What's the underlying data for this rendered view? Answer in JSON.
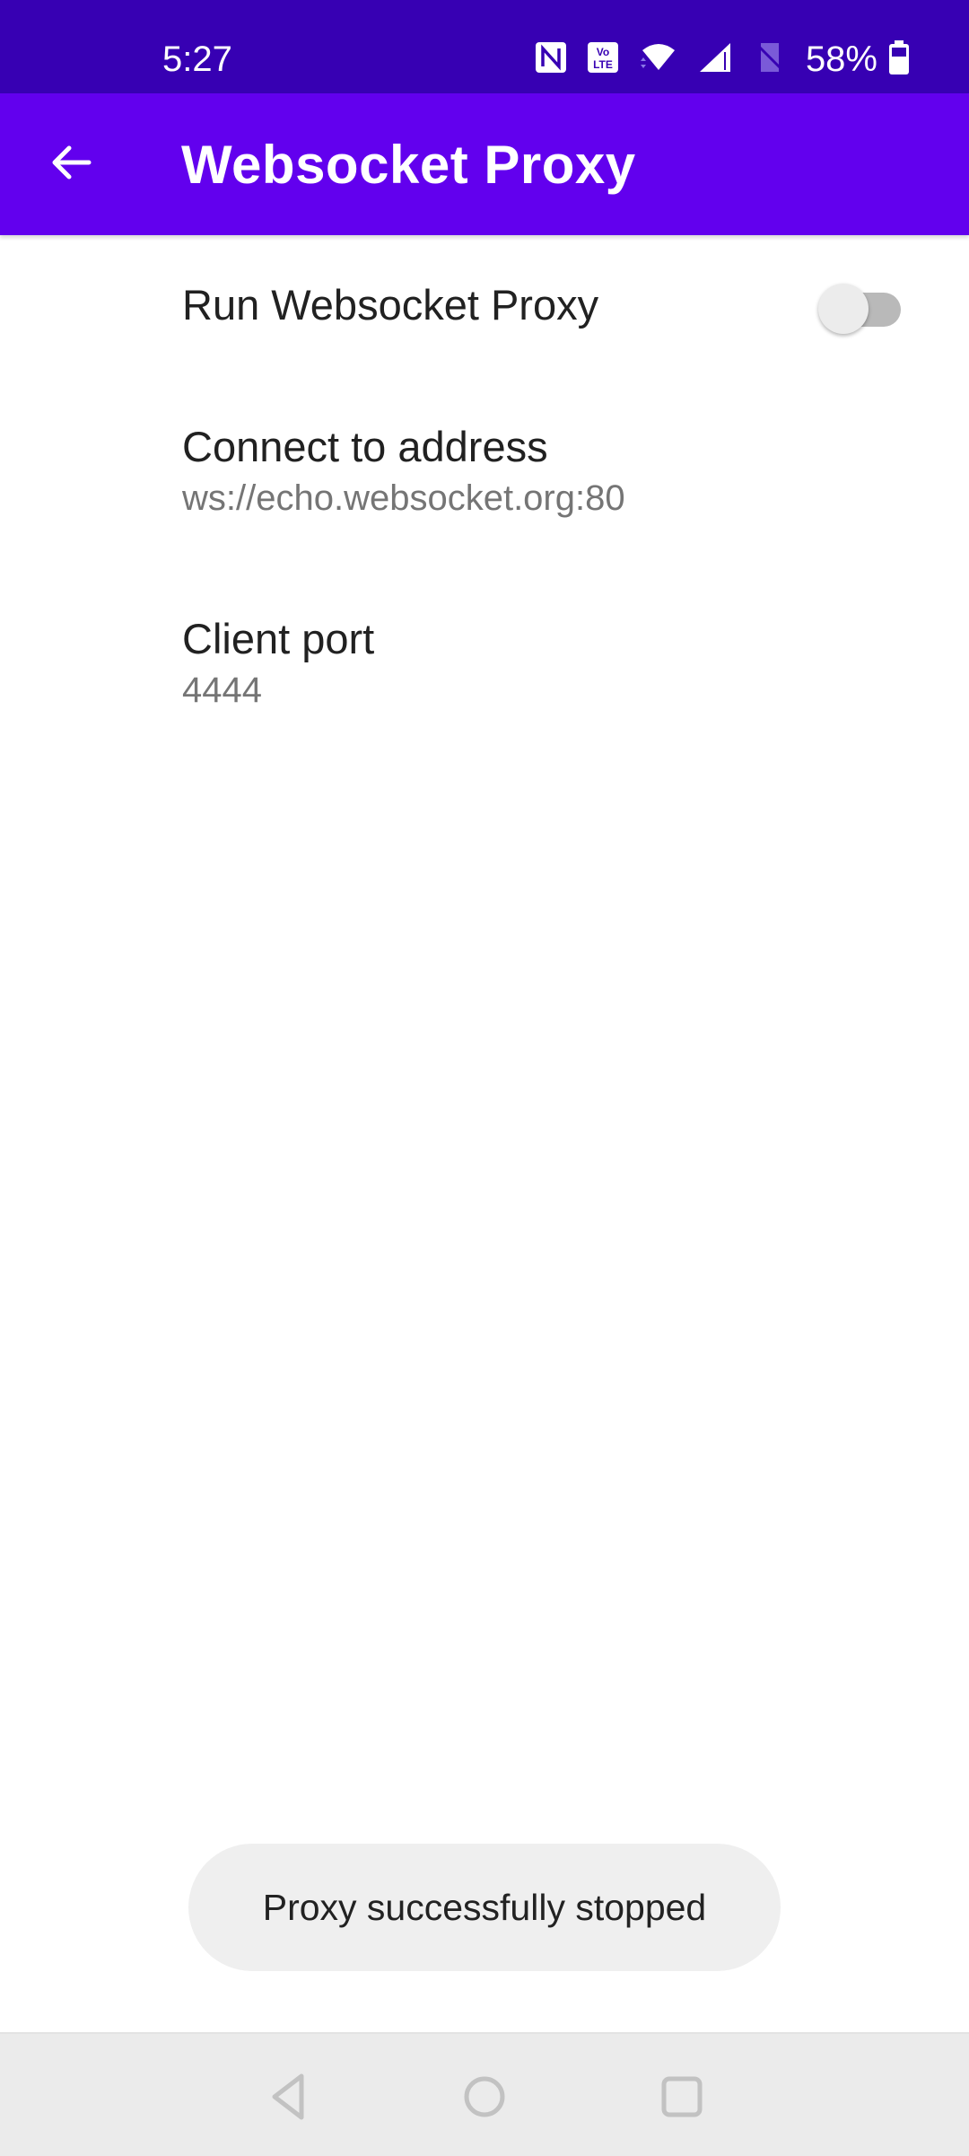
{
  "status_bar": {
    "time": "5:27",
    "battery_percent": "58%",
    "icons": [
      "nfc-icon",
      "volte-icon",
      "wifi-icon",
      "cell-signal-icon",
      "no-sim-icon",
      "battery-icon"
    ]
  },
  "app_bar": {
    "title": "Websocket Proxy",
    "back_icon": "arrow-back-icon"
  },
  "preferences": {
    "run_proxy": {
      "title": "Run Websocket Proxy",
      "enabled": false
    },
    "connect_address": {
      "title": "Connect to address",
      "value": "ws://echo.websocket.org:80"
    },
    "client_port": {
      "title": "Client port",
      "value": "4444"
    }
  },
  "toast": {
    "message": "Proxy successfully stopped"
  },
  "nav_bar": {
    "buttons": [
      "back-nav-icon",
      "home-nav-icon",
      "recents-nav-icon"
    ]
  },
  "colors": {
    "status_bar": "#3700B3",
    "app_bar": "#6200EE",
    "toast_bg": "#EFEFEF",
    "nav_bar": "#EBEBEB"
  }
}
